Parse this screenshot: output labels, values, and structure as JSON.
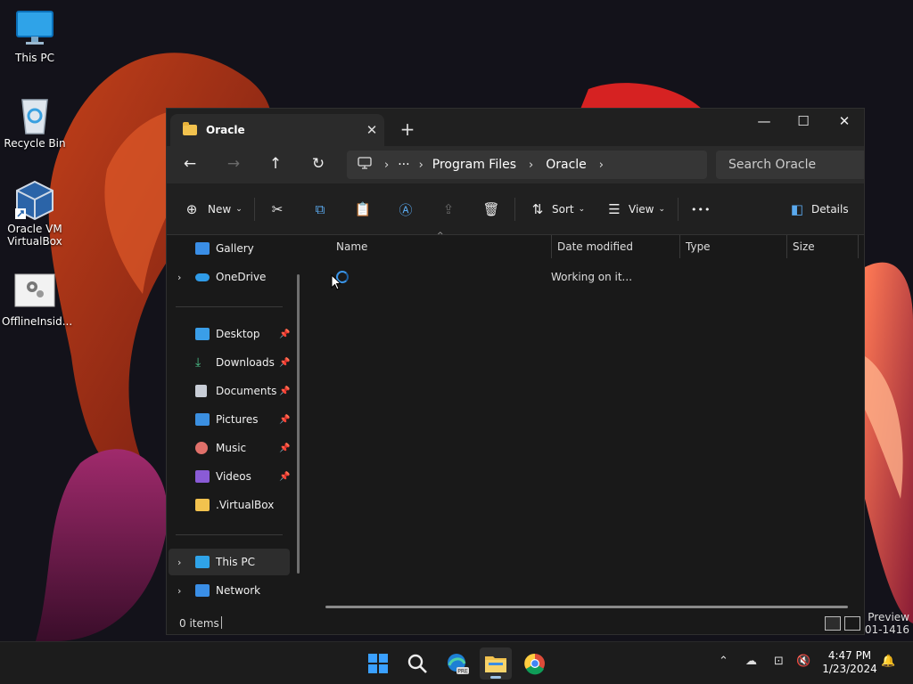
{
  "desktop": {
    "icons": [
      {
        "label": "This PC"
      },
      {
        "label": "Recycle Bin"
      },
      {
        "label": "Oracle VM VirtualBox"
      },
      {
        "label": "OfflineInsid..."
      }
    ],
    "watermark": {
      "line1": "r Preview",
      "line2": "0901-1416"
    }
  },
  "window": {
    "tab_title": "Oracle",
    "tab_close": "✕",
    "new_tab": "+",
    "controls": {
      "minimize": "—",
      "maximize": "☐",
      "close": "✕"
    },
    "nav": {
      "back": "←",
      "forward": "→",
      "up": "↑",
      "refresh": "↻"
    },
    "address": {
      "overflow": "···",
      "crumbs": [
        "Program Files",
        "Oracle"
      ],
      "separator": "›"
    },
    "search_placeholder": "Search Oracle",
    "toolbar": {
      "new": "New",
      "sort": "Sort",
      "view": "View",
      "more": "•••",
      "details": "Details"
    },
    "sidebar": {
      "gallery": "Gallery",
      "onedrive": "OneDrive",
      "desktop": "Desktop",
      "downloads": "Downloads",
      "documents": "Documents",
      "pictures": "Pictures",
      "music": "Music",
      "videos": "Videos",
      "virtualbox": ".VirtualBox",
      "this_pc": "This PC",
      "network": "Network"
    },
    "columns": {
      "name": "Name",
      "date_modified": "Date modified",
      "type": "Type",
      "size": "Size"
    },
    "status_working": "Working on it...",
    "status_items": "0 items"
  },
  "taskbar": {
    "clock_time": "4:47 PM",
    "clock_date": "1/23/2024"
  },
  "colors": {
    "accent": "#3b95e8",
    "folder": "#f2c24e",
    "window_bg": "#191919"
  }
}
